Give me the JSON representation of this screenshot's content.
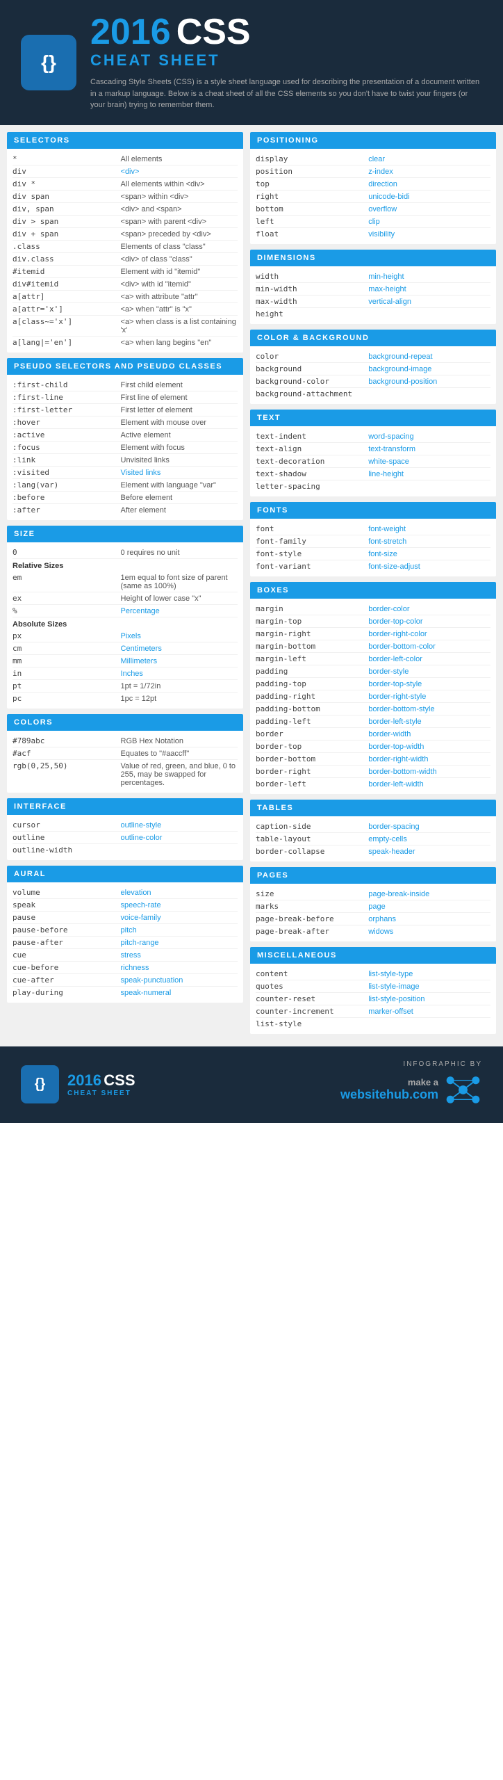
{
  "header": {
    "year": "2016",
    "css": "CSS",
    "cheat_sheet": "CHEAT SHEET",
    "description": "Cascading Style Sheets (CSS) is a style sheet language used for describing the presentation of a document written in a markup language. Below is a cheat sheet of all the CSS elements so you don't have to twist your fingers (or your brain) trying to remember them.",
    "logo_symbol": "{}"
  },
  "sections": {
    "selectors": {
      "title": "SELECTORS",
      "items": [
        {
          "name": "*",
          "value": "All elements"
        },
        {
          "name": "div",
          "value": "<div>"
        },
        {
          "name": "div *",
          "value": "All elements within <div>"
        },
        {
          "name": "div span",
          "value": "<span> within <div>"
        },
        {
          "name": "div, span",
          "value": "<div> and <span>"
        },
        {
          "name": "div > span",
          "value": "<span> with parent <div>"
        },
        {
          "name": "div + span",
          "value": "<span> preceded by <div>"
        },
        {
          "name": ".class",
          "value": "Elements of class \"class\""
        },
        {
          "name": "div.class",
          "value": "<div> of class \"class\""
        },
        {
          "name": "#itemid",
          "value": "Element with id \"itemid\""
        },
        {
          "name": "div#itemid",
          "value": "<div> with id \"itemid\""
        },
        {
          "name": "a[attr]",
          "value": "<a> with attribute \"attr\""
        },
        {
          "name": "a[attr='x']",
          "value": "<a> when \"attr\" is \"x\""
        },
        {
          "name": "a[class~='x']",
          "value": "<a> when class is a list containing 'x'"
        },
        {
          "name": "a[lang|='en']",
          "value": "<a> when lang begins \"en\""
        }
      ]
    },
    "pseudo": {
      "title": "PSEUDO SELECTORS AND PSEUDO CLASSES",
      "items": [
        {
          "name": ":first-child",
          "value": "First child element"
        },
        {
          "name": ":first-line",
          "value": "First line of element"
        },
        {
          "name": ":first-letter",
          "value": "First letter of element"
        },
        {
          "name": ":hover",
          "value": "Element with mouse over"
        },
        {
          "name": ":active",
          "value": "Active element"
        },
        {
          "name": ":focus",
          "value": "Element with focus"
        },
        {
          "name": ":link",
          "value": "Unvisited links"
        },
        {
          "name": ":visited",
          "value": "Visited links"
        },
        {
          "name": ":lang(var)",
          "value": "Element with language \"var\""
        },
        {
          "name": ":before",
          "value": "Before element"
        },
        {
          "name": ":after",
          "value": "After element"
        }
      ]
    },
    "size": {
      "title": "SIZE",
      "absolute_header": "Absolute Sizes",
      "relative_header": "Relative Sizes",
      "zero": {
        "name": "0",
        "value": "0 requires no unit"
      },
      "relative_items": [
        {
          "name": "em",
          "value": "1em equal to font size of parent (same as 100%)"
        },
        {
          "name": "ex",
          "value": "Height of lower case \"x\""
        },
        {
          "name": "%",
          "value": "Percentage"
        }
      ],
      "absolute_items": [
        {
          "name": "px",
          "value": "Pixels"
        },
        {
          "name": "cm",
          "value": "Centimeters"
        },
        {
          "name": "mm",
          "value": "Millimeters"
        },
        {
          "name": "in",
          "value": "Inches"
        },
        {
          "name": "pt",
          "value": "1pt = 1/72in"
        },
        {
          "name": "pc",
          "value": "1pc = 12pt"
        }
      ]
    },
    "colors": {
      "title": "COLORS",
      "items": [
        {
          "name": "#789abc",
          "value": "RGB Hex Notation"
        },
        {
          "name": "#acf",
          "value": "Equates to \"#aaccff\""
        },
        {
          "name": "rgb(0,25,50)",
          "value": "Value of red, green, and blue, 0 to 255, may be swapped for percentages."
        }
      ]
    },
    "interface": {
      "title": "INTERFACE",
      "items": [
        {
          "name": "cursor",
          "value": "outline-style"
        },
        {
          "name": "outline",
          "value": "outline-color"
        },
        {
          "name": "outline-width",
          "value": ""
        }
      ]
    },
    "aural": {
      "title": "AURAL",
      "items": [
        {
          "name": "volume",
          "value": "elevation"
        },
        {
          "name": "speak",
          "value": "speech-rate"
        },
        {
          "name": "pause",
          "value": "voice-family"
        },
        {
          "name": "pause-before",
          "value": "pitch"
        },
        {
          "name": "pause-after",
          "value": "pitch-range"
        },
        {
          "name": "cue",
          "value": "stress"
        },
        {
          "name": "cue-before",
          "value": "richness"
        },
        {
          "name": "cue-after",
          "value": "speak-punctuation"
        },
        {
          "name": "play-during",
          "value": "speak-numeral"
        }
      ]
    },
    "positioning": {
      "title": "POSITIONING",
      "items": [
        {
          "name": "display",
          "value": "clear"
        },
        {
          "name": "position",
          "value": "z-index"
        },
        {
          "name": "top",
          "value": "direction"
        },
        {
          "name": "right",
          "value": "unicode-bidi"
        },
        {
          "name": "bottom",
          "value": "overflow"
        },
        {
          "name": "left",
          "value": "clip"
        },
        {
          "name": "float",
          "value": "visibility"
        }
      ]
    },
    "dimensions": {
      "title": "DIMENSIONS",
      "items": [
        {
          "name": "width",
          "value": "min-height"
        },
        {
          "name": "min-width",
          "value": "max-height"
        },
        {
          "name": "max-width",
          "value": "vertical-align"
        },
        {
          "name": "height",
          "value": ""
        }
      ]
    },
    "color_background": {
      "title": "COLOR & BACKGROUND",
      "items": [
        {
          "name": "color",
          "value": "background-repeat"
        },
        {
          "name": "background",
          "value": "background-image"
        },
        {
          "name": "background-color",
          "value": "background-position"
        },
        {
          "name": "background-attachment",
          "value": ""
        }
      ]
    },
    "text": {
      "title": "TEXT",
      "items": [
        {
          "name": "text-indent",
          "value": "word-spacing"
        },
        {
          "name": "text-align",
          "value": "text-transform"
        },
        {
          "name": "text-decoration",
          "value": "white-space"
        },
        {
          "name": "text-shadow",
          "value": "line-height"
        },
        {
          "name": "letter-spacing",
          "value": ""
        }
      ]
    },
    "fonts": {
      "title": "FONTS",
      "items": [
        {
          "name": "font",
          "value": "font-weight"
        },
        {
          "name": "font-family",
          "value": "font-stretch"
        },
        {
          "name": "font-style",
          "value": "font-size"
        },
        {
          "name": "font-variant",
          "value": "font-size-adjust"
        }
      ]
    },
    "boxes": {
      "title": "BOXES",
      "items": [
        {
          "name": "margin",
          "value": "border-color"
        },
        {
          "name": "margin-top",
          "value": "border-top-color"
        },
        {
          "name": "margin-right",
          "value": "border-right-color"
        },
        {
          "name": "margin-bottom",
          "value": "border-bottom-color"
        },
        {
          "name": "margin-left",
          "value": "border-left-color"
        },
        {
          "name": "padding",
          "value": "border-style"
        },
        {
          "name": "padding-top",
          "value": "border-top-style"
        },
        {
          "name": "padding-right",
          "value": "border-right-style"
        },
        {
          "name": "padding-bottom",
          "value": "border-bottom-style"
        },
        {
          "name": "padding-left",
          "value": "border-left-style"
        },
        {
          "name": "border",
          "value": "border-width"
        },
        {
          "name": "border-top",
          "value": "border-top-width"
        },
        {
          "name": "border-bottom",
          "value": "border-right-width"
        },
        {
          "name": "border-right",
          "value": "border-bottom-width"
        },
        {
          "name": "border-left",
          "value": "border-left-width"
        }
      ]
    },
    "tables": {
      "title": "TABLES",
      "items": [
        {
          "name": "caption-side",
          "value": "border-spacing"
        },
        {
          "name": "table-layout",
          "value": "empty-cells"
        },
        {
          "name": "border-collapse",
          "value": "speak-header"
        }
      ]
    },
    "pages": {
      "title": "PAGES",
      "items": [
        {
          "name": "size",
          "value": "page-break-inside"
        },
        {
          "name": "marks",
          "value": "page"
        },
        {
          "name": "page-break-before",
          "value": "orphans"
        },
        {
          "name": "page-break-after",
          "value": "widows"
        }
      ]
    },
    "miscellaneous": {
      "title": "MISCELLANEOUS",
      "items": [
        {
          "name": "content",
          "value": "list-style-type"
        },
        {
          "name": "quotes",
          "value": "list-style-image"
        },
        {
          "name": "counter-reset",
          "value": "list-style-position"
        },
        {
          "name": "counter-increment",
          "value": "marker-offset"
        },
        {
          "name": "list-style",
          "value": ""
        }
      ]
    }
  },
  "footer": {
    "logo_symbol": "{}",
    "year": "2016",
    "css": "CSS",
    "cheat_sheet": "CHEAT SHEET",
    "infographic_by": "INFOGRAPHIC BY",
    "brand_line1": "make a",
    "brand_line2": "websitehub.com"
  }
}
